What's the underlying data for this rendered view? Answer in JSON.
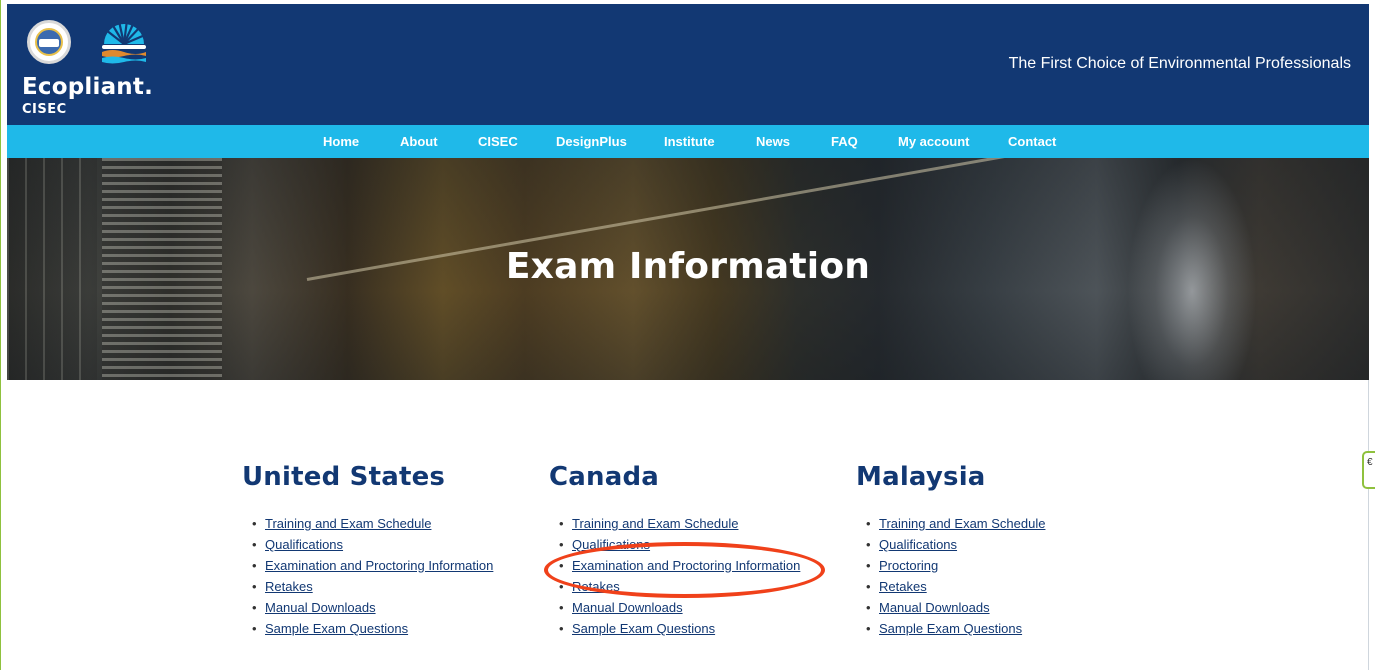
{
  "header": {
    "brand_name": "Ecopliant.",
    "brand_sub": "CISEC",
    "seal_text": "CISEC",
    "tagline": "The First Choice of Environmental Professionals"
  },
  "nav": {
    "items": [
      "Home",
      "About",
      "CISEC",
      "DesignPlus",
      "Institute",
      "News",
      "FAQ",
      "My account",
      "Contact"
    ]
  },
  "hero": {
    "title": "Exam Information"
  },
  "sections": [
    {
      "title": "United States",
      "links": [
        "Training and Exam Schedule",
        "Qualifications",
        "Examination and Proctoring Information",
        "Retakes",
        "Manual Downloads",
        "Sample Exam Questions"
      ]
    },
    {
      "title": "Canada",
      "links": [
        "Training and Exam Schedule",
        "Qualifications",
        "Examination and Proctoring Information",
        "Retakes",
        "Manual Downloads",
        "Sample Exam Questions"
      ]
    },
    {
      "title": "Malaysia",
      "links": [
        "Training and Exam Schedule",
        "Qualifications",
        "Proctoring",
        "Retakes",
        "Manual Downloads",
        "Sample Exam Questions"
      ]
    }
  ],
  "side_tab": {
    "text": "€"
  },
  "colors": {
    "header_bg": "#123873",
    "nav_bg": "#1fb9e9",
    "heading": "#123873",
    "link": "#123873",
    "annotation": "#f0411a",
    "page_border": "#8fc13e"
  },
  "icons": [
    "cisec-seal-icon",
    "ecopliant-sun-logo-icon"
  ]
}
